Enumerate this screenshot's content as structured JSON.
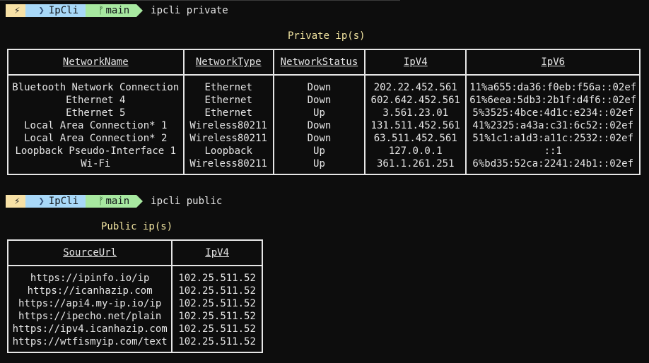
{
  "prompts": [
    {
      "bolt": "⚡",
      "dir": "IpCli",
      "branch_icon": "ᚠ",
      "branch": "main",
      "command": "ipcli private"
    },
    {
      "bolt": "⚡",
      "dir": "IpCli",
      "branch_icon": "ᚠ",
      "branch": "main",
      "command": "ipcli public"
    }
  ],
  "private": {
    "caption": "Private ip(s)",
    "headers": [
      "NetworkName",
      "NetworkType",
      "NetworkStatus",
      "IpV4",
      "IpV6"
    ],
    "rows": [
      [
        "Bluetooth Network Connection",
        "Ethernet",
        "Down",
        "202.22.452.561",
        "11%a655:da36:f0eb:f56a::02ef"
      ],
      [
        "Ethernet 4",
        "Ethernet",
        "Down",
        "602.642.452.561",
        "61%6eea:5db3:2b1f:d4f6::02ef"
      ],
      [
        "Ethernet 5",
        "Ethernet",
        "Up",
        "3.561.23.01",
        "5%3525:4bce:4d1c:e234::02ef"
      ],
      [
        "Local Area Connection* 1",
        "Wireless80211",
        "Down",
        "131.511.452.561",
        "41%2325:a43a:c31:6c52::02ef"
      ],
      [
        "Local Area Connection* 2",
        "Wireless80211",
        "Down",
        "63.511.452.561",
        "51%1c1:a1d3:a11c:2532::02ef"
      ],
      [
        "Loopback Pseudo-Interface 1",
        "Loopback",
        "Up",
        "127.0.0.1",
        "::1"
      ],
      [
        "Wi-Fi",
        "Wireless80211",
        "Up",
        "361.1.261.251",
        "6%bd35:52ca:2241:24b1::02ef"
      ]
    ]
  },
  "public": {
    "caption": "Public ip(s)",
    "headers": [
      "SourceUrl",
      "IpV4"
    ],
    "rows": [
      [
        "https://ipinfo.io/ip",
        "102.25.511.52"
      ],
      [
        "https://icanhazip.com",
        "102.25.511.52"
      ],
      [
        "https://api4.my-ip.io/ip",
        "102.25.511.52"
      ],
      [
        "https://ipecho.net/plain",
        "102.25.511.52"
      ],
      [
        "https://ipv4.icanhazip.com",
        "102.25.511.52"
      ],
      [
        "https://wtfismyip.com/text",
        "102.25.511.52"
      ]
    ]
  }
}
